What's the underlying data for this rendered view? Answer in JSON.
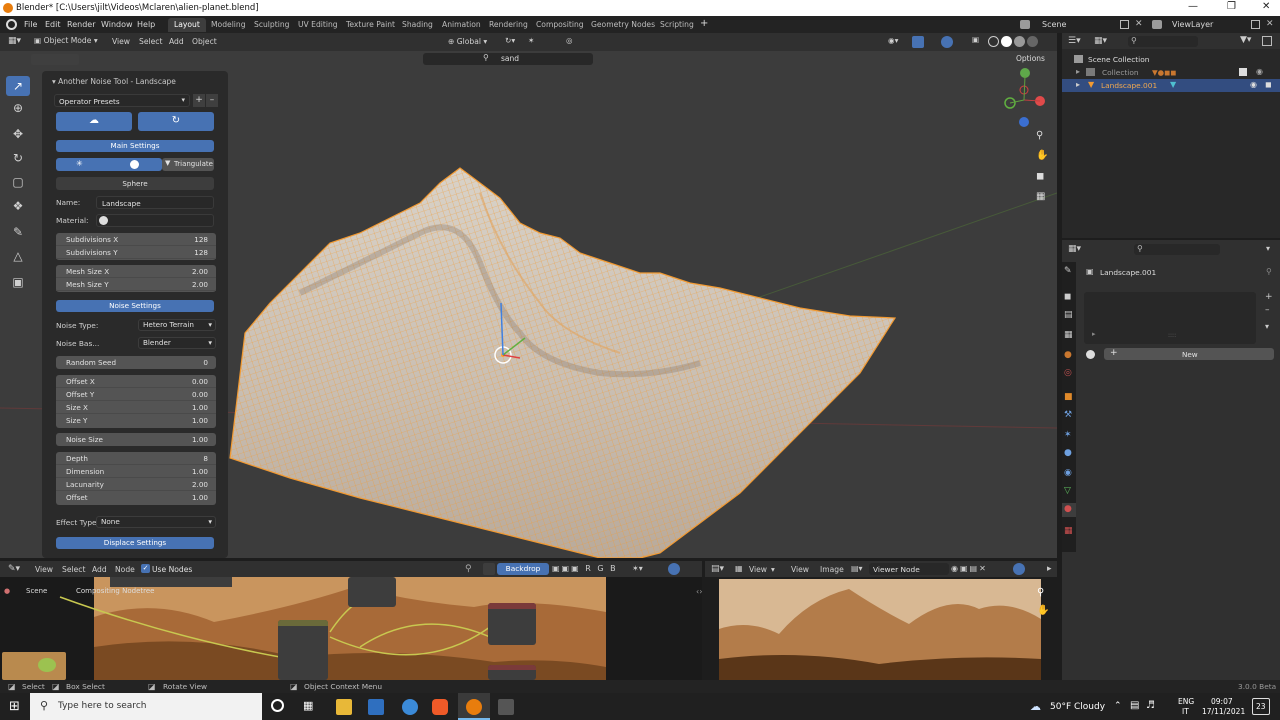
{
  "window": {
    "title": "Blender* [C:\\Users\\jilt\\Videos\\Mclaren\\alien-planet.blend]"
  },
  "menu": {
    "file": "File",
    "edit": "Edit",
    "render": "Render",
    "window": "Window",
    "help": "Help"
  },
  "workspaces": [
    "Layout",
    "Modeling",
    "Sculpting",
    "UV Editing",
    "Texture Paint",
    "Shading",
    "Animation",
    "Rendering",
    "Compositing",
    "Geometry Nodes",
    "Scripting"
  ],
  "scene": {
    "name": "Scene",
    "view_layer": "ViewLayer"
  },
  "viewport": {
    "mode": "Object Mode",
    "view": "View",
    "select": "Select",
    "add": "Add",
    "object": "Object",
    "orientation": "Global",
    "search_value": "sand",
    "options": "Options"
  },
  "panel": {
    "title": "Another Noise Tool - Landscape",
    "operator_presets": "Operator Presets",
    "main_settings": "Main Settings",
    "triangulate": "Triangulate",
    "sphere": "Sphere",
    "name_label": "Name:",
    "name_value": "Landscape",
    "material_label": "Material:",
    "subdiv_x_l": "Subdivisions X",
    "subdiv_x_v": "128",
    "subdiv_y_l": "Subdivisions Y",
    "subdiv_y_v": "128",
    "mesh_x_l": "Mesh Size X",
    "mesh_x_v": "2.00",
    "mesh_y_l": "Mesh Size Y",
    "mesh_y_v": "2.00",
    "noise_settings": "Noise Settings",
    "noise_type_l": "Noise Type:",
    "noise_type_v": "Hetero Terrain",
    "noise_basis_l": "Noise Bas...",
    "noise_basis_v": "Blender",
    "random_seed_l": "Random Seed",
    "random_seed_v": "0",
    "offset_x_l": "Offset X",
    "offset_x_v": "0.00",
    "offset_y_l": "Offset Y",
    "offset_y_v": "0.00",
    "size_x_l": "Size X",
    "size_x_v": "1.00",
    "size_y_l": "Size Y",
    "size_y_v": "1.00",
    "noise_size_l": "Noise Size",
    "noise_size_v": "1.00",
    "depth_l": "Depth",
    "depth_v": "8",
    "dimension_l": "Dimension",
    "dimension_v": "1.00",
    "lacunarity_l": "Lacunarity",
    "lacunarity_v": "2.00",
    "offset_l": "Offset",
    "offset_v": "1.00",
    "effect_type_l": "Effect Type:",
    "effect_type_v": "None",
    "displace_settings": "Displace Settings"
  },
  "outliner": {
    "root": "Scene Collection",
    "collection": "Collection",
    "object": "Landscape.001"
  },
  "properties": {
    "object": "Landscape.001",
    "new": "New"
  },
  "node_editor": {
    "view": "View",
    "select": "Select",
    "add": "Add",
    "node": "Node",
    "use_nodes": "Use Nodes",
    "backdrop": "Backdrop",
    "breadcrumb_scene": "Scene",
    "breadcrumb_tree": "Compositing Nodetree"
  },
  "image_editor": {
    "view": "View",
    "view2": "View",
    "image": "Image",
    "viewer": "Viewer Node"
  },
  "status": {
    "select": "Select",
    "box_select": "Box Select",
    "rotate": "Rotate View",
    "context": "Object Context Menu",
    "version": "3.0.0 Beta"
  },
  "taskbar": {
    "search_placeholder": "Type here to search",
    "weather": "50°F  Cloudy",
    "lang": "ENG",
    "region": "IT",
    "time": "09:07",
    "date": "17/11/2021",
    "notif": "23"
  },
  "colors": {
    "accent": "#4772b3",
    "terrain_wire": "#f29a32",
    "viewport_bg": "#3c3c3c",
    "panel_bg": "#2a2a2a"
  }
}
